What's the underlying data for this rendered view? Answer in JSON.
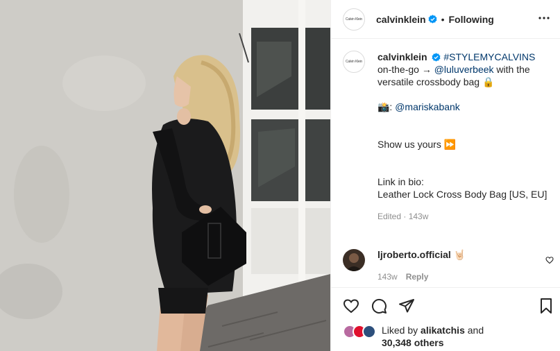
{
  "post": {
    "account": "calvinklein",
    "avatar_text": "Calvin Klein",
    "verified_icon": "verified-badge-icon",
    "separator": "•",
    "follow_status": "Following",
    "caption": {
      "username": "calvinklein",
      "hashtag": "#STYLEMYCALVINS",
      "line1_prefix": "on-the-go →",
      "mention1": "@luluverbeek",
      "line1_suffix": "with the versatile crossbody bag 🔒",
      "photo_credit_emoji": "📸:",
      "mention2": "@mariskabank",
      "line_show": "Show us yours ⏩",
      "link_label": "Link in bio:",
      "product": "Leather Lock Cross Body Bag [US, EU]",
      "edited": "Edited · 143w"
    },
    "comment": {
      "username": "ljroberto.official",
      "text": "🤘🏻",
      "age": "143w",
      "reply_label": "Reply"
    },
    "likes": {
      "prefix": "Liked by",
      "user": "alikatchis",
      "and": "and",
      "others": "30,348 others"
    }
  },
  "colors": {
    "verified_blue": "#0095f6",
    "link_blue": "#00376b",
    "text": "#262626",
    "secondary": "#8e8e8e",
    "divider": "#efefef"
  }
}
